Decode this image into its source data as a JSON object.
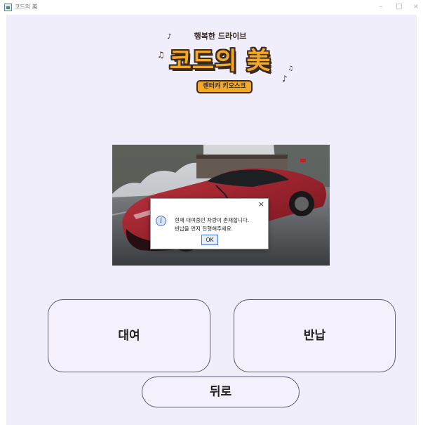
{
  "window": {
    "title": "코드의 美",
    "minimize_glyph": "–",
    "maximize_glyph": "□",
    "close_glyph": "×"
  },
  "logo": {
    "subtitle": "행복한 드라이브",
    "title": "코드의 美",
    "tag": "렌터카 키오스크",
    "note1": "♪",
    "note2": "♫",
    "note3": "♫",
    "note4": "♪"
  },
  "dialog": {
    "icon_glyph": "i",
    "line1": "현재 대여중인 차량이 존재합니다.",
    "line2": "반납을 먼저 진행해주세요.",
    "ok_label": "OK",
    "close_glyph": "×"
  },
  "buttons": {
    "rent_label": "대여",
    "return_label": "반납",
    "back_label": "뒤로"
  },
  "colors": {
    "background": "#f1eefb",
    "logo_orange": "#f2a92a",
    "logo_brown": "#3a2a20",
    "car_red": "#b32433"
  }
}
